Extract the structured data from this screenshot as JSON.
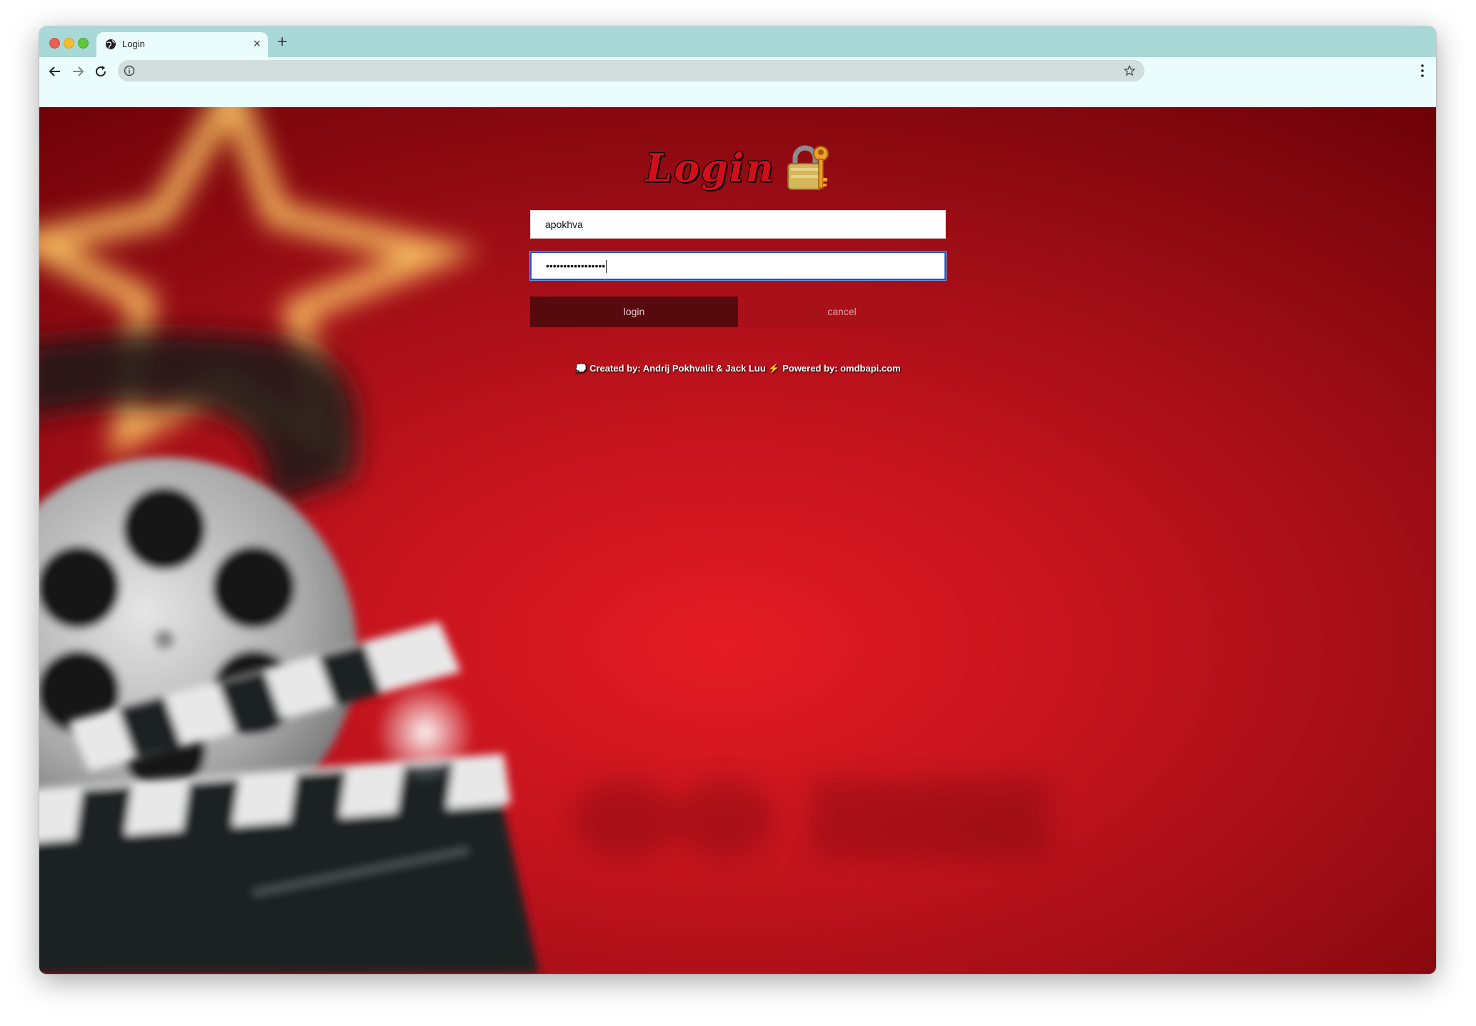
{
  "browser": {
    "tab_title": "Login",
    "tab_close": "×",
    "new_tab": "+",
    "address": ""
  },
  "icons": {
    "tab_favicon": "globe-icon",
    "back": "arrow-left-icon",
    "forward": "arrow-right-icon",
    "reload": "reload-icon",
    "site_info": "info-icon",
    "bookmark": "star-icon",
    "menu": "kebab-menu-icon",
    "title_icon": "lock-with-key-icon",
    "footer_lead": "speech-bubble-icon",
    "footer_sep": "lightning-icon"
  },
  "login": {
    "title": "Login",
    "username_value": "apokhva",
    "password_masked": "•••••••••••••••••",
    "login_button": "login",
    "cancel_button": "cancel"
  },
  "footer": {
    "lead_icon": "💭",
    "created_by": "Created by: Andrij Pokhvalit & Jack Luu",
    "separator_icon": "⚡",
    "powered_by": "Powered by: omdbapi.com"
  },
  "colors": {
    "tabstrip": "#a8d9d6",
    "toolbar": "#eafdfc",
    "background_center": "#e41b23",
    "background_edge": "#6a0107",
    "login_button": "#570a0e",
    "cancel_button": "#a9111a",
    "focus_ring": "#1a56c7"
  }
}
